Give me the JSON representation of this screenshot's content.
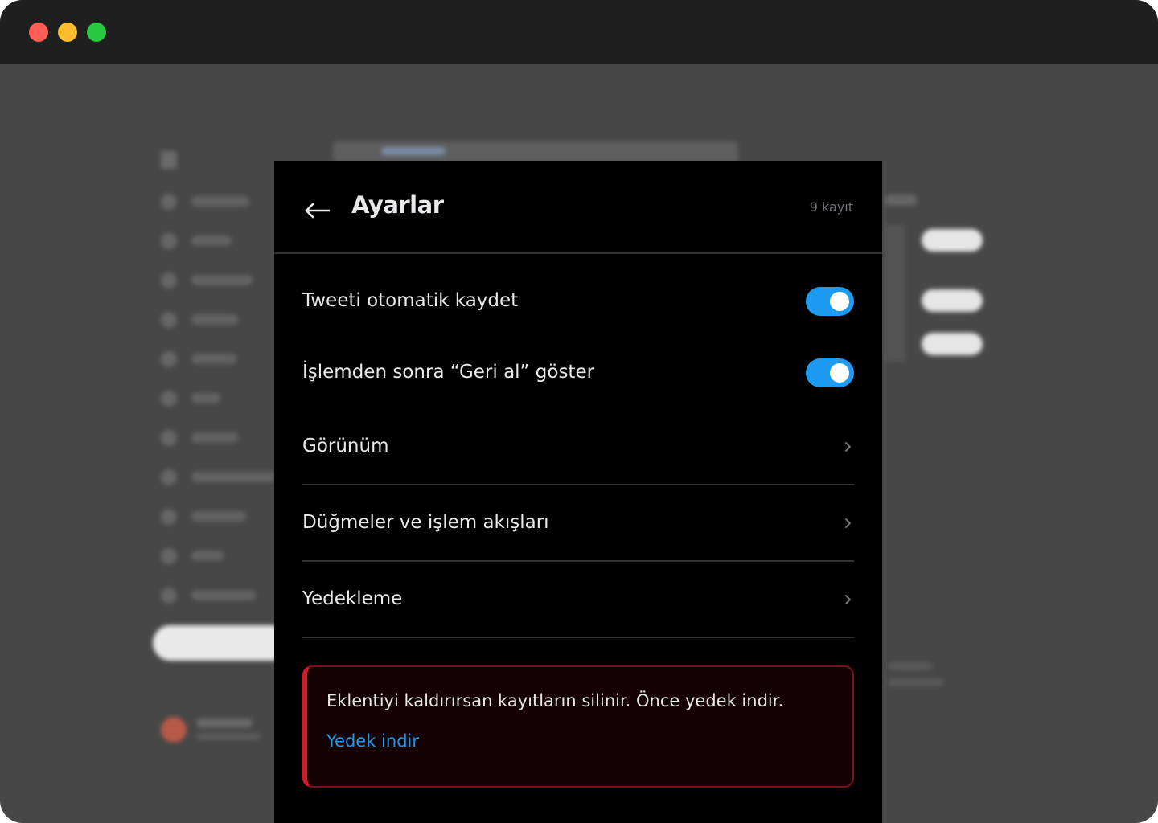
{
  "window": {
    "controls": [
      "close",
      "minimize",
      "maximize"
    ]
  },
  "settings": {
    "title": "Ayarlar",
    "record_count": "9 kayıt",
    "toggles": [
      {
        "label": "Tweeti otomatik kaydet",
        "enabled": true
      },
      {
        "label": "İşlemden sonra “Geri al” göster",
        "enabled": true
      }
    ],
    "nav_items": [
      {
        "label": "Görünüm"
      },
      {
        "label": "Düğmeler ve işlem akışları"
      },
      {
        "label": "Yedekleme"
      }
    ],
    "warning": {
      "message": "Eklentiyi kaldırırsan kayıtların silinir. Önce yedek indir.",
      "link": "Yedek indir"
    }
  },
  "colors": {
    "accent": "#1d9bf0",
    "danger": "#d61a2a",
    "panel_bg": "#000000",
    "text": "#e7e9ea",
    "muted": "#71767b"
  }
}
